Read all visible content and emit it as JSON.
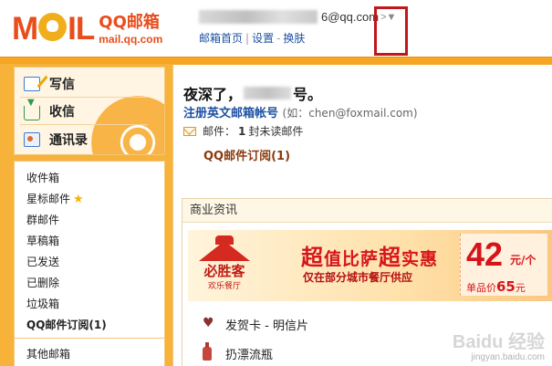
{
  "header": {
    "logo_main": "MOIL",
    "logo_title": "QQ邮箱",
    "logo_url": "mail.qq.com",
    "account_suffix": "6@qq.com",
    "account_arrow": ">▼",
    "links": [
      "邮箱首页",
      "设置",
      "换肤"
    ]
  },
  "sidebar": {
    "actions": {
      "compose": "写信",
      "receive": "收信",
      "contacts": "通讯录"
    },
    "folders": {
      "inbox": "收件箱",
      "starred": "星标邮件",
      "group": "群邮件",
      "drafts": "草稿箱",
      "sent": "已发送",
      "deleted": "已删除",
      "spam": "垃圾箱",
      "subscriptions": "QQ邮件订阅(1)",
      "other": "其他邮箱"
    }
  },
  "main": {
    "greeting_prefix": "夜深了，",
    "greeting_suffix": "号。",
    "register_title": "注册英文邮箱帐号",
    "register_hint": "(如：chen@foxmail.com)",
    "mail_label": "邮件：",
    "unread_count": "1",
    "unread_text": "封未读邮件",
    "subscription_link": "QQ邮件订阅(1)"
  },
  "news": {
    "section_title": "商业资讯",
    "ad": {
      "brand": "必胜客",
      "brand_sub": "欢乐餐厅",
      "title_1": "超",
      "title_2": "值比萨",
      "title_3": "超",
      "title_4": "实惠",
      "subtitle": "仅在部分城市餐厅供应",
      "price": "42",
      "price_unit": "元/个",
      "single_label": "单品价",
      "single_price": "65",
      "single_unit": "元"
    },
    "items": [
      "发贺卡 - 明信片",
      "扔漂流瓶"
    ]
  },
  "watermark": {
    "text": "Baidu 经验",
    "sub": "jingyan.baidu.com"
  }
}
